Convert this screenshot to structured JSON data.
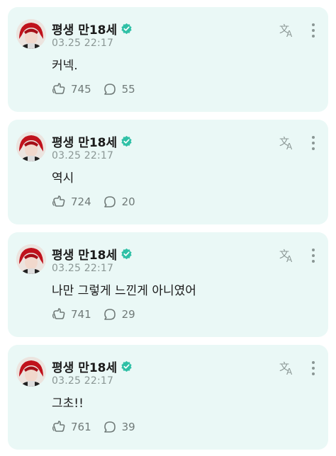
{
  "colors": {
    "card_bg": "#eaf8f6",
    "verified": "#2fc0a6",
    "muted": "#8a9694"
  },
  "icons": [
    "avatar",
    "verified-badge-icon",
    "translate-icon",
    "more-vert-icon",
    "like-icon",
    "comment-icon"
  ],
  "posts": [
    {
      "author": "평생 만18세",
      "time": "03.25 22:17",
      "text": "커넥.",
      "likes": "745",
      "comments": "55"
    },
    {
      "author": "평생 만18세",
      "time": "03.25 22:17",
      "text": "역시",
      "likes": "724",
      "comments": "20"
    },
    {
      "author": "평생 만18세",
      "time": "03.25 22:17",
      "text": "나만 그렇게 느낀게 아니였어",
      "likes": "741",
      "comments": "29"
    },
    {
      "author": "평생 만18세",
      "time": "03.25 22:17",
      "text": "그초!!",
      "likes": "761",
      "comments": "39"
    }
  ]
}
